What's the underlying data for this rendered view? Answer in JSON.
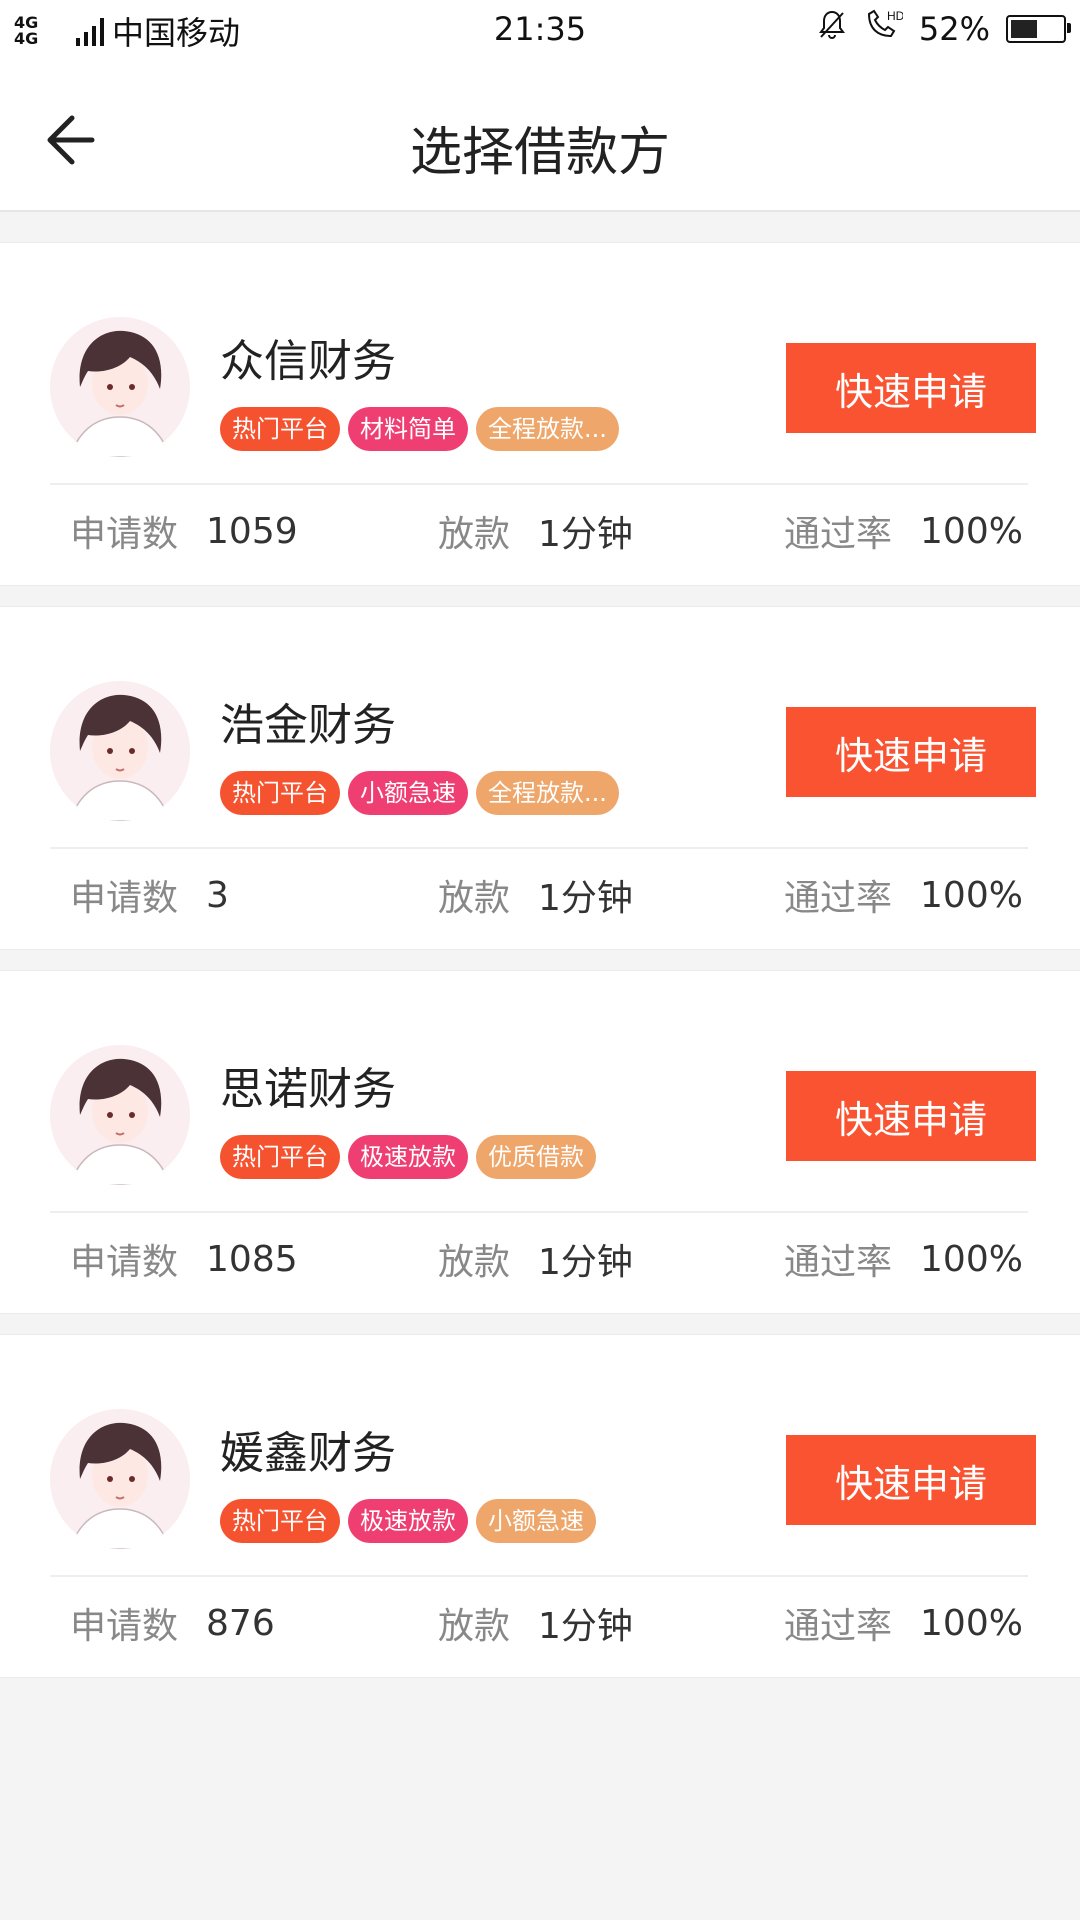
{
  "status_bar": {
    "network": "4G 4G",
    "carrier": "中国移动",
    "time": "21:35",
    "battery": "52%",
    "battery_level": 0.52
  },
  "header": {
    "title": "选择借款方"
  },
  "colors": {
    "primary": "#fa5331",
    "tag_red": "#f5522f",
    "tag_pink": "#ef3f72",
    "tag_orange": "#eea66a"
  },
  "lenders": [
    {
      "name": "众信财务",
      "tags": [
        "热门平台",
        "材料简单",
        "全程放款..."
      ],
      "apply_label": "快速申请",
      "apps_label": "申请数",
      "apps_value": "1059",
      "loan_label": "放款",
      "loan_value": "1分钟",
      "rate_label": "通过率",
      "rate_value": "100%"
    },
    {
      "name": "浩金财务",
      "tags": [
        "热门平台",
        "小额急速",
        "全程放款..."
      ],
      "apply_label": "快速申请",
      "apps_label": "申请数",
      "apps_value": "3",
      "loan_label": "放款",
      "loan_value": "1分钟",
      "rate_label": "通过率",
      "rate_value": "100%"
    },
    {
      "name": "思诺财务",
      "tags": [
        "热门平台",
        "极速放款",
        "优质借款"
      ],
      "apply_label": "快速申请",
      "apps_label": "申请数",
      "apps_value": "1085",
      "loan_label": "放款",
      "loan_value": "1分钟",
      "rate_label": "通过率",
      "rate_value": "100%"
    },
    {
      "name": "媛鑫财务",
      "tags": [
        "热门平台",
        "极速放款",
        "小额急速"
      ],
      "apply_label": "快速申请",
      "apps_label": "申请数",
      "apps_value": "876",
      "loan_label": "放款",
      "loan_value": "1分钟",
      "rate_label": "通过率",
      "rate_value": "100%"
    }
  ]
}
